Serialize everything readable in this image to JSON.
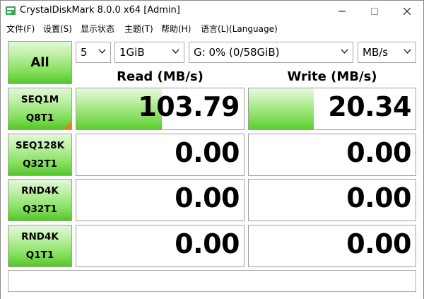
{
  "window": {
    "title": "CrystalDiskMark 8.0.0 x64 [Admin]"
  },
  "menu": [
    "文件(F)",
    "设置(S)",
    "显示状态",
    "主题(T)",
    "帮助(H)",
    "语言(L)(Language)"
  ],
  "controls": {
    "all_label": "All",
    "count": "5",
    "size": "1GiB",
    "drive": "G: 0% (0/58GiB)",
    "unit": "MB/s"
  },
  "headers": {
    "read": "Read (MB/s)",
    "write": "Write (MB/s)"
  },
  "tests": [
    {
      "line1": "SEQ1M",
      "line2": "Q8T1",
      "read": "103.79",
      "write": "20.34",
      "read_fill": 0.51,
      "write_fill": 0.39
    },
    {
      "line1": "SEQ128K",
      "line2": "Q32T1",
      "read": "0.00",
      "write": "0.00",
      "read_fill": 0,
      "write_fill": 0
    },
    {
      "line1": "RND4K",
      "line2": "Q32T1",
      "read": "0.00",
      "write": "0.00",
      "read_fill": 0,
      "write_fill": 0
    },
    {
      "line1": "RND4K",
      "line2": "Q1T1",
      "read": "0.00",
      "write": "0.00",
      "read_fill": 0,
      "write_fill": 0
    }
  ],
  "comment": "",
  "colors": {
    "accent_green": "#54c72a",
    "corner_mark": "#f07a1a"
  }
}
